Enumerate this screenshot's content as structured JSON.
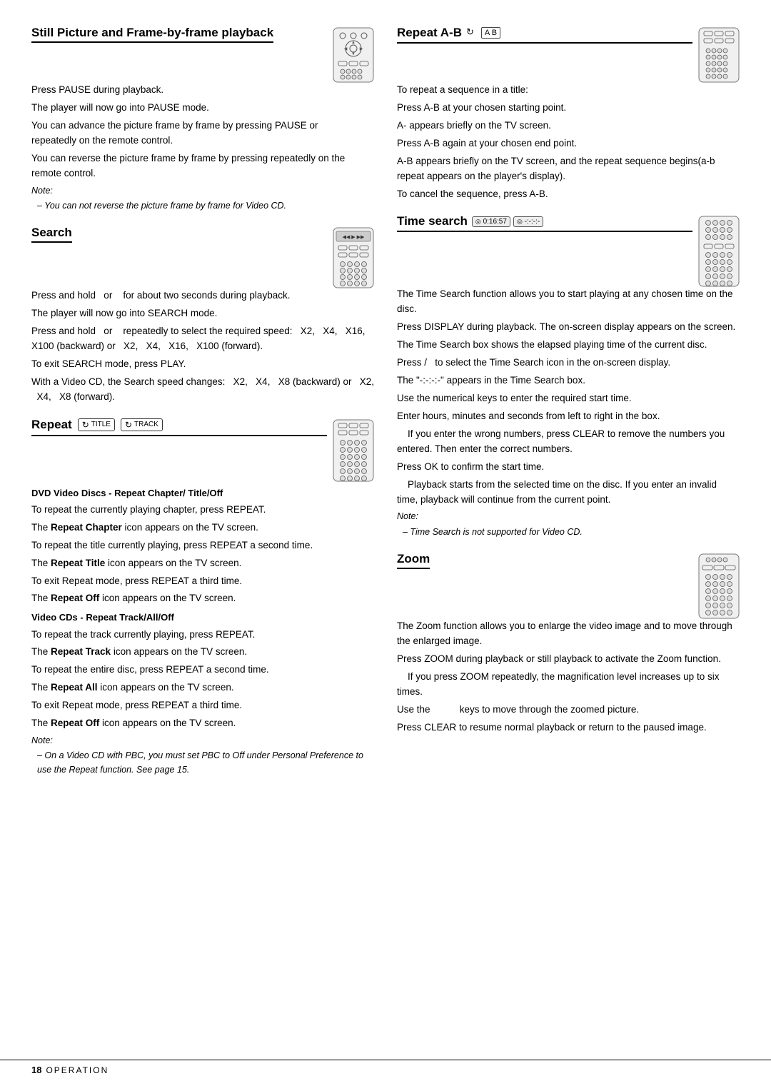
{
  "page": {
    "number": "18",
    "label": "Operation"
  },
  "stillPicture": {
    "title": "Still Picture and Frame-by-frame playback",
    "body": [
      "Press PAUSE during playback.",
      "The player will now go into PAUSE mode.",
      "You can advance the picture frame by frame by pressing PAUSE or     repeatedly on the remote control.",
      "You can reverse the picture frame by frame by pressing repeatedly on the remote control."
    ],
    "note_label": "Note:",
    "note_text": "– You can not reverse the picture frame by frame for Video CD."
  },
  "search": {
    "title": "Search",
    "body": [
      "Press and hold   or     for about two seconds during playback.",
      "The player will now go into SEARCH mode.",
      "Press and hold   or     repeatedly to select the required speed:   X2,   X4,   X16,   X100 (backward) or   X2,   X4,   X16,   X100 (forward).",
      "To exit SEARCH mode, press PLAY.",
      "With a Video CD, the Search speed changes:   X2,   X4,   X8 (backward) or   X2,   X4,   X8 (forward)."
    ]
  },
  "repeat": {
    "title": "Repeat",
    "icons": [
      "TITLE",
      "TRACK"
    ],
    "dvd_heading": "DVD Video Discs - Repeat Chapter/ Title/Off",
    "dvd_body": [
      "To repeat the currently playing chapter, press REPEAT.",
      "The Repeat Chapter icon appears on the TV screen.",
      "To repeat the title currently playing, press REPEAT a second time.",
      "The Repeat Title icon appears on the TV screen.",
      "To exit Repeat mode, press REPEAT a third time.",
      "The Repeat Off icon appears on the TV screen."
    ],
    "vcd_heading": "Video CDs - Repeat Track/All/Off",
    "vcd_body": [
      "To repeat the track currently playing, press REPEAT.",
      "The Repeat Track icon appears on the TV screen.",
      "To repeat the entire disc, press REPEAT a second time.",
      "The Repeat All icon appears on the TV screen.",
      "To exit Repeat mode, press REPEAT a third time.",
      "The Repeat Off icon appears on the TV screen."
    ],
    "note_label": "Note:",
    "note_text": "– On a Video CD with PBC, you must set PBC to Off under Personal Preference to use the Repeat function. See page 15."
  },
  "repeatAB": {
    "title": "Repeat A-B",
    "badge": "A  B",
    "body": [
      "To repeat a sequence in a title:",
      "Press A-B at your chosen starting point.",
      "A- appears briefly on the TV screen.",
      "Press A-B again at your chosen end point.",
      "A-B appears briefly on the TV screen, and the repeat sequence begins(a-b repeat appears on the player's display).",
      "To cancel the sequence, press A-B."
    ]
  },
  "timeSearch": {
    "title": "Time search",
    "time1": "0:16:57",
    "time2": "-:-:-:-",
    "body": [
      "The Time Search function allows you to start playing at any chosen time on the disc.",
      "Press DISPLAY during playback. The on-screen display appears on the screen.",
      "The Time Search box shows the elapsed playing time of the current disc.",
      "Press / to select the Time Search icon in the on-screen display.",
      "The \"-:-:-:-\" appears in the Time Search box.",
      "Use the numerical keys to enter the required start time.",
      "Enter hours, minutes and seconds from left to right in the box.",
      "If you enter the wrong numbers, press CLEAR to remove the numbers you entered. Then enter the correct numbers.",
      "Press OK to confirm the start time.",
      "Playback starts from the selected time on the disc. If you enter an invalid time, playback will continue from the current point."
    ],
    "note_label": "Note:",
    "note_text": "– Time Search is not supported for Video CD."
  },
  "zoom": {
    "title": "Zoom",
    "body": [
      "The Zoom function allows you to enlarge the video image and to move through the enlarged image.",
      "Press ZOOM during playback or still playback to activate the Zoom function.",
      "If you press ZOOM repeatedly, the magnification level increases up to six times.",
      "Use the           keys to move through the zoomed picture.",
      "Press CLEAR to resume normal playback or return to the paused image."
    ]
  }
}
